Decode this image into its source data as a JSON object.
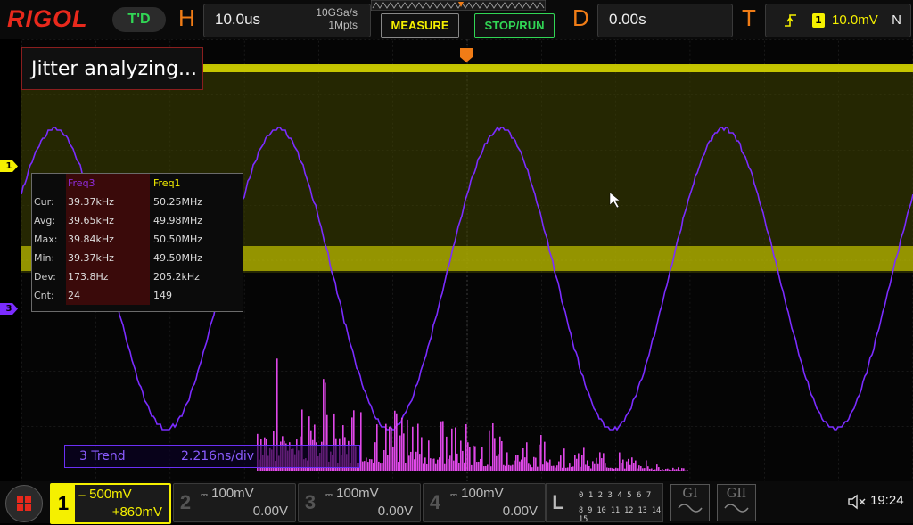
{
  "brand": "RIGOL",
  "mode_badge": "T'D",
  "horizontal": {
    "letter": "H",
    "timebase": "10.0us",
    "sample_rate": "10GSa/s",
    "memory_depth": "1Mpts"
  },
  "buttons": {
    "measure": "MEASURE",
    "stop_run": "STOP/RUN"
  },
  "delay": {
    "letter": "D",
    "value": "0.00s"
  },
  "trigger": {
    "letter": "T",
    "level": "10.0mV",
    "mode": "N",
    "source": "1"
  },
  "status_message": "Jitter analyzing...",
  "channel_markers": {
    "ch1": "1",
    "ch3": "3"
  },
  "measurements": {
    "headers": [
      "Freq3",
      "Freq1"
    ],
    "rows": [
      {
        "label": "Cur:",
        "a": "39.37kHz",
        "b": "50.25MHz"
      },
      {
        "label": "Avg:",
        "a": "39.65kHz",
        "b": "49.98MHz"
      },
      {
        "label": "Max:",
        "a": "39.84kHz",
        "b": "50.50MHz"
      },
      {
        "label": "Min:",
        "a": "39.37kHz",
        "b": "49.50MHz"
      },
      {
        "label": "Dev:",
        "a": "173.8Hz",
        "b": "205.2kHz"
      },
      {
        "label": "Cnt:",
        "a": "24",
        "b": "149"
      }
    ]
  },
  "trend": {
    "label": "3 Trend",
    "scale": "2.216ns/div"
  },
  "channels": [
    {
      "num": "1",
      "scale": "500mV",
      "offset": "+860mV",
      "active": true
    },
    {
      "num": "2",
      "scale": "100mV",
      "offset": "0.00V",
      "active": false
    },
    {
      "num": "3",
      "scale": "100mV",
      "offset": "0.00V",
      "active": false
    },
    {
      "num": "4",
      "scale": "100mV",
      "offset": "0.00V",
      "active": false
    }
  ],
  "logic": {
    "letter": "L",
    "row1": "0 1 2 3  4 5 6 7",
    "row2": "8 9 10 11 12 13 14 15"
  },
  "generators": [
    "GI",
    "GII"
  ],
  "clock": "19:24",
  "colors": {
    "ch1": "#f5f000",
    "ch3": "#7b2cff",
    "trend": "#e048e8",
    "accent": "#f07c16",
    "green": "#31d655"
  }
}
